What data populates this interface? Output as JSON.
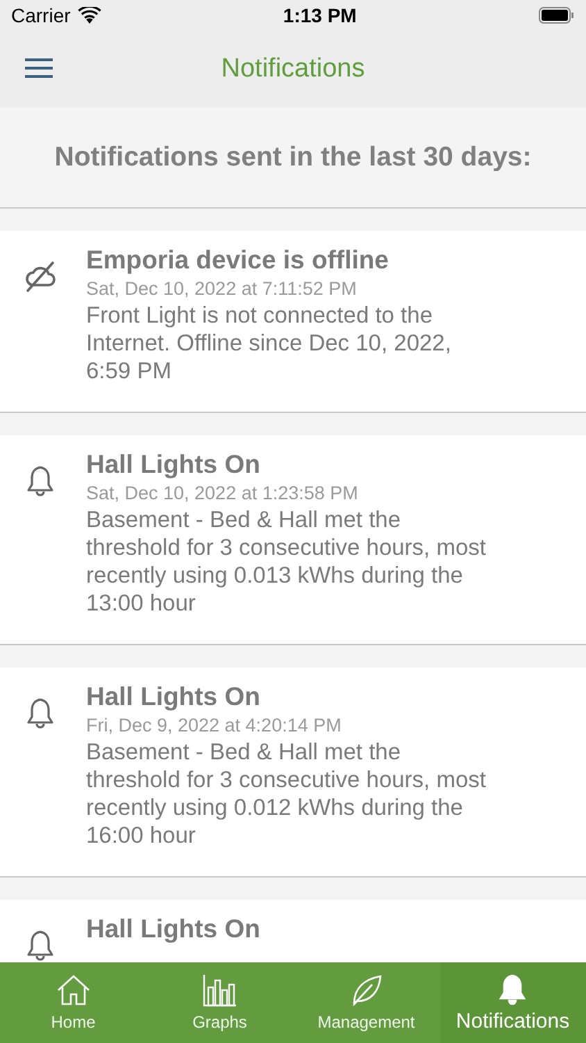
{
  "status_bar": {
    "carrier": "Carrier",
    "time": "1:13 PM"
  },
  "nav_bar": {
    "title": "Notifications"
  },
  "header": "Notifications sent in the last 30 days:",
  "notifications": [
    {
      "kind": "offline",
      "title": "Emporia device is offline",
      "date": "Sat, Dec 10, 2022 at 7:11:52 PM",
      "message": "Front Light is not connected to the Internet. Offline since Dec 10, 2022, 6:59 PM"
    },
    {
      "kind": "alert",
      "title": "Hall Lights On",
      "date": "Sat, Dec 10, 2022 at 1:23:58 PM",
      "message": "Basement - Bed & Hall met the threshold for 3 consecutive hours, most recently using 0.013 kWhs during the 13:00 hour"
    },
    {
      "kind": "alert",
      "title": "Hall Lights On",
      "date": "Fri, Dec 9, 2022 at 4:20:14 PM",
      "message": "Basement - Bed & Hall met the threshold for 3 consecutive hours, most recently using 0.012 kWhs during the 16:00 hour"
    },
    {
      "kind": "alert",
      "title": "Hall Lights On"
    }
  ],
  "tab_bar": [
    {
      "kind": "home",
      "label": "Home",
      "selected": false
    },
    {
      "kind": "graphs",
      "label": "Graphs",
      "selected": false
    },
    {
      "kind": "management",
      "label": "Management",
      "selected": false
    },
    {
      "kind": "notifications",
      "label": "Notifications",
      "selected": true
    }
  ]
}
